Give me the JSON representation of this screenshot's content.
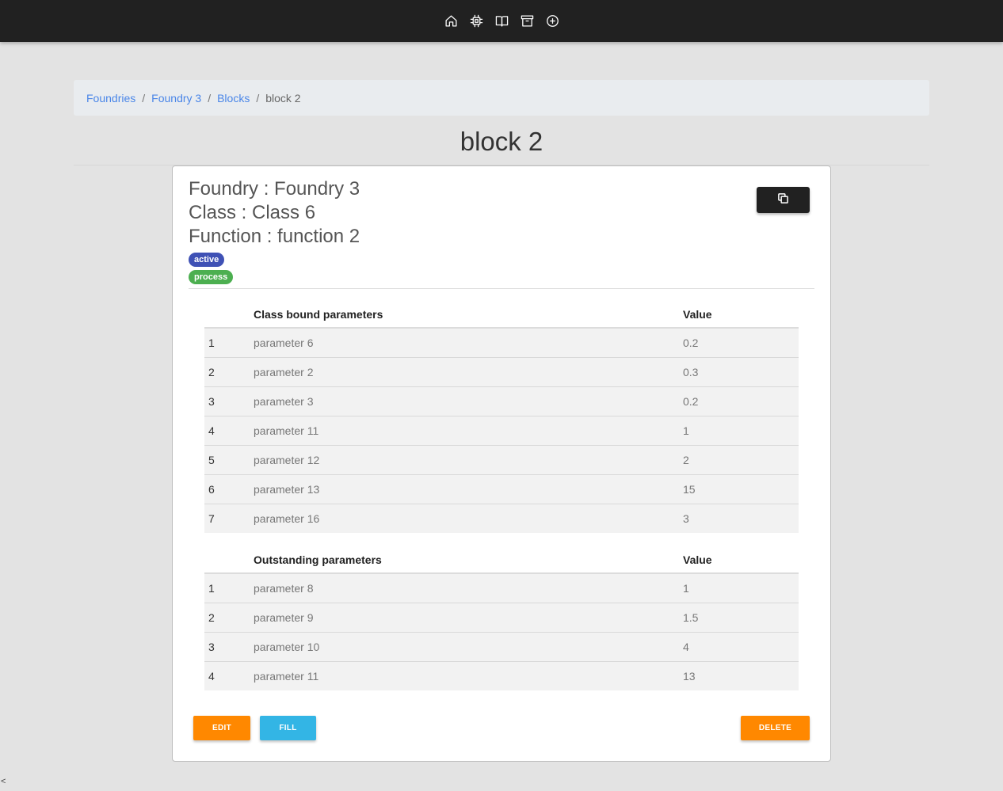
{
  "topbar": {
    "icons": [
      "home-icon",
      "chip-icon",
      "book-icon",
      "archive-icon",
      "plus-circle-icon"
    ]
  },
  "breadcrumb": {
    "items": [
      "Foundries",
      "Foundry 3",
      "Blocks"
    ],
    "current": "block 2",
    "separator": "/"
  },
  "page": {
    "title": "block 2"
  },
  "card": {
    "foundry_line": "Foundry : Foundry 3",
    "class_line": "Class : Class 6",
    "function_line": "Function : function 2",
    "badges": [
      {
        "label": "active",
        "color": "#3f51b5"
      },
      {
        "label": "process",
        "color": "#4caf50"
      }
    ],
    "copy_button_icon": "copy-icon"
  },
  "class_bound_table": {
    "headers": [
      "",
      "Class bound parameters",
      "Value"
    ],
    "rows": [
      [
        "1",
        "parameter 6",
        "0.2"
      ],
      [
        "2",
        "parameter 2",
        "0.3"
      ],
      [
        "3",
        "parameter 3",
        "0.2"
      ],
      [
        "4",
        "parameter 11",
        "1"
      ],
      [
        "5",
        "parameter 12",
        "2"
      ],
      [
        "6",
        "parameter 13",
        "15"
      ],
      [
        "7",
        "parameter 16",
        "3"
      ]
    ]
  },
  "outstanding_table": {
    "headers": [
      "",
      "Outstanding parameters",
      "Value"
    ],
    "rows": [
      [
        "1",
        "parameter 8",
        "1"
      ],
      [
        "2",
        "parameter 9",
        "1.5"
      ],
      [
        "3",
        "parameter 10",
        "4"
      ],
      [
        "4",
        "parameter 11",
        "13"
      ]
    ]
  },
  "actions": {
    "edit_label": "EDIT",
    "fill_label": "FILL",
    "delete_label": "DELETE"
  },
  "corner": {
    "glyph": "<"
  }
}
